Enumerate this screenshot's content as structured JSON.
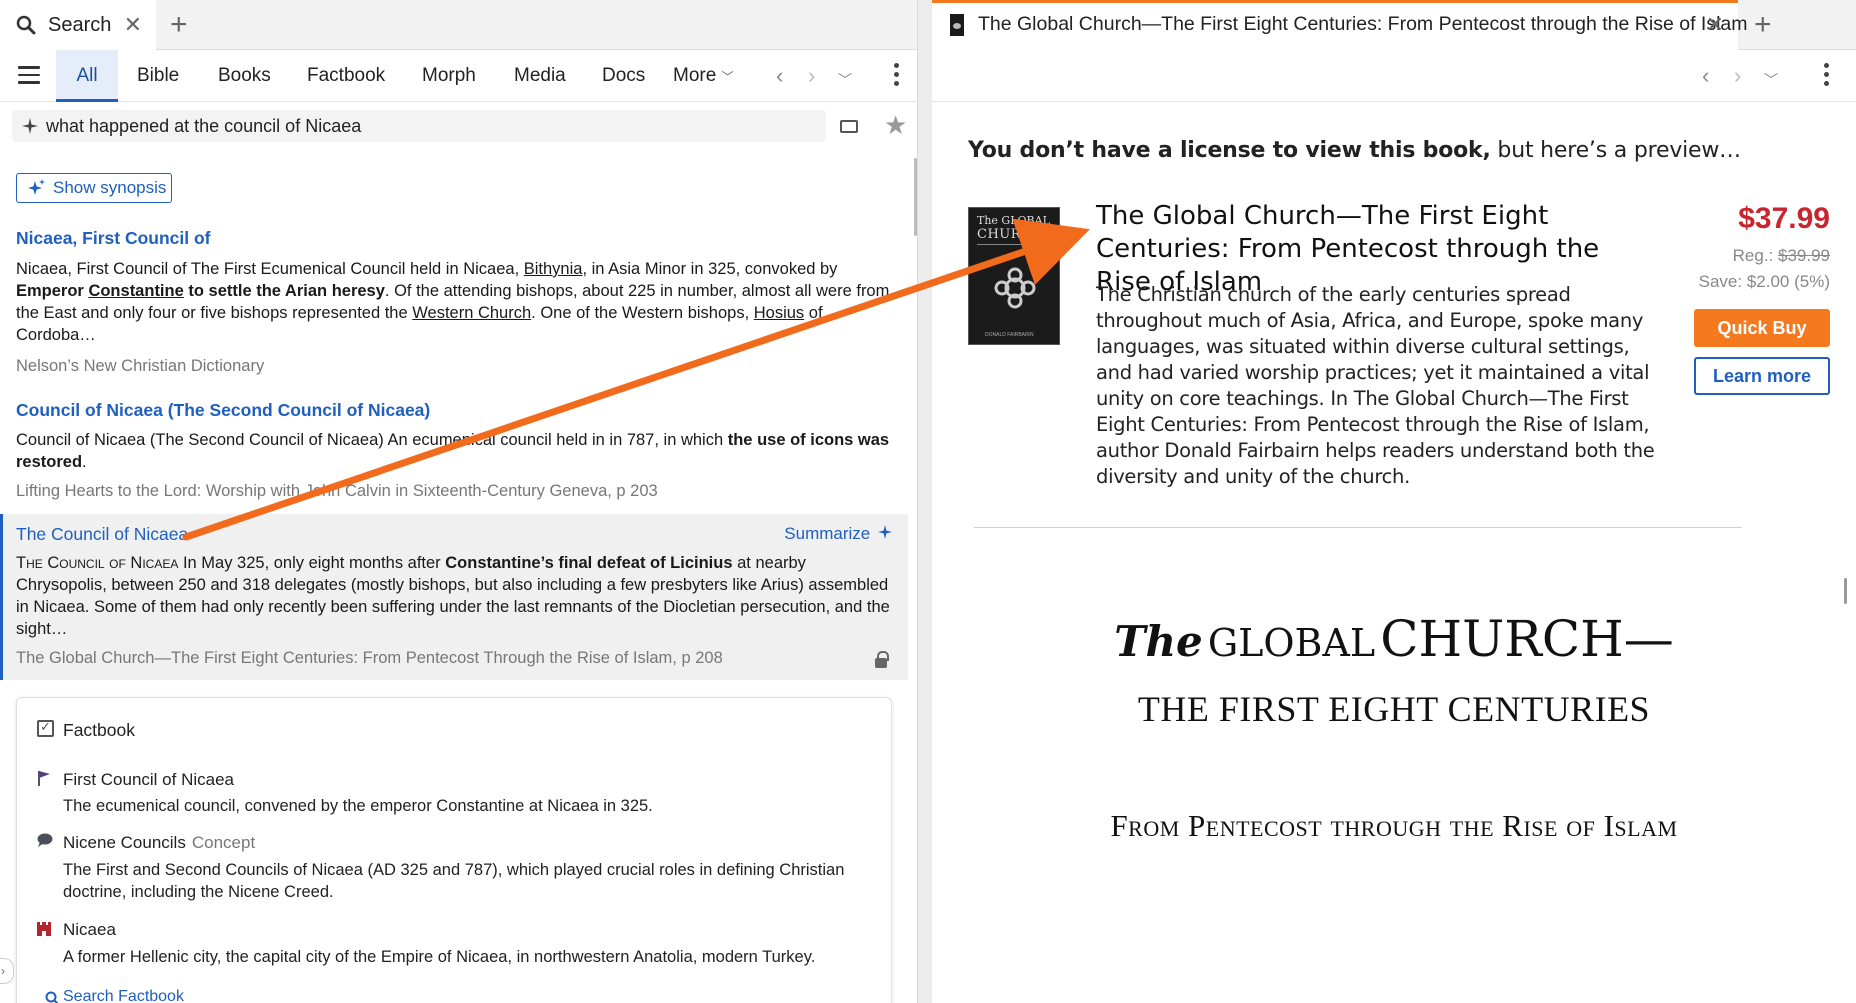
{
  "left": {
    "tab": {
      "label": "Search"
    },
    "nav": {
      "tabs": [
        "All",
        "Bible",
        "Books",
        "Factbook",
        "Morph",
        "Media",
        "Docs"
      ],
      "more_label": "More"
    },
    "search": {
      "value": "what happened at the council of Nicaea"
    },
    "synopsis_label": "Show synopsis",
    "results": [
      {
        "title": "Nicaea, First Council of",
        "body": {
          "p1": "Nicaea, First Council of The First Ecumenical Council held in Nicaea, ",
          "u1": "Bithynia",
          "p2": ", in Asia Minor in 325, convoked by ",
          "b1": "Emperor ",
          "bu1": "Constantine",
          "b2": " to settle the Arian heresy",
          "p3": ". Of the attending bishops, about 225 in number, almost all were from the East and only four or five bishops represented the ",
          "u2": "Western Church",
          "p4": ". One of the Western bishops, ",
          "u3": "Hosius",
          "p5": " of Cordoba…"
        },
        "source": "Nelson’s New Christian Dictionary"
      },
      {
        "title": "Council of Nicaea (The Second Council of Nicaea)",
        "body": {
          "p1": "Council of Nicaea (The Second Council of Nicaea) An ecumenical council held in in 787, in which ",
          "b1": "the use of icons was restored",
          "p2": "."
        },
        "source": "Lifting Hearts to the Lord: Worship with John Calvin in Sixteenth-Century Geneva, p 203"
      },
      {
        "title": "The Council of Nicaea",
        "summarize_label": "Summarize",
        "body": {
          "sc1": "The Council of Nicaea",
          "p1": " In May 325, only eight months after ",
          "b1": "Constantine’s final defeat of Licinius",
          "p2": " at nearby Chrysopolis, between 250 and 318 delegates (mostly bishops, but also including a few presbyters like Arius) assembled in Nicaea. Some of them had only recently been suffering under the last remnants of the Diocletian persecution, and the sight…"
        },
        "source": "The Global Church—The First Eight Centuries: From Pentecost Through the Rise of Islam, p 208"
      }
    ],
    "factbook": {
      "header": "Factbook",
      "items": [
        {
          "title": "First Council of Nicaea",
          "concept": "",
          "desc": "The ecumenical council, convened by the emperor Constantine at Nicaea in 325.",
          "icon": "flag-icon"
        },
        {
          "title": "Nicene Councils",
          "concept": "Concept",
          "desc": "The First and Second Councils of Nicaea (AD 325 and 787), which played crucial roles in defining Christian doctrine, including the Nicene Creed.",
          "icon": "speech-bubble-icon"
        },
        {
          "title": "Nicaea",
          "concept": "",
          "desc": "A former Hellenic city, the capital city of the Empire of Nicaea, in northwestern Anatolia, modern Turkey.",
          "icon": "castle-icon"
        }
      ],
      "search_label": "Search Factbook"
    }
  },
  "right": {
    "tab": {
      "label": "The Global Church—The First Eight Centuries: From Pentecost through the Rise of Islam"
    },
    "license": {
      "bold": "You don’t have a license to view this book,",
      "rest": " but here’s a preview…"
    },
    "cover": {
      "line1": "The GLOBAL",
      "line2": "CHURCH",
      "author": "DONALD FAIRBAIRN"
    },
    "product": {
      "title": "The Global Church—The First Eight Centuries: From Pentecost through the Rise of Islam",
      "description": "The Christian church of the early centuries spread throughout much of Asia, Africa, and Europe, spoke many languages, was situated within diverse cultural settings, and had varied worship practices; yet it maintained a vital unity on core teachings. In The Global Church—The First Eight Centuries: From Pentecost through the Rise of Islam, author Donald Fairbairn helps readers understand both the diversity and unity of the church.",
      "price": "$37.99",
      "reg_label": "Reg.: ",
      "reg_price": "$39.99",
      "save": "Save: $2.00 (5%)",
      "quick_buy": "Quick Buy",
      "learn_more": "Learn more"
    },
    "book_title": {
      "the": "The",
      "global": "GLOBAL",
      "church": "CHURCH—",
      "line2": "THE FIRST EIGHT CENTURIES",
      "line3": "From Pentecost through the Rise of Islam"
    }
  },
  "colors": {
    "accent": "#1f5fbf",
    "orange": "#f57a1f",
    "price_red": "#c8262e"
  }
}
